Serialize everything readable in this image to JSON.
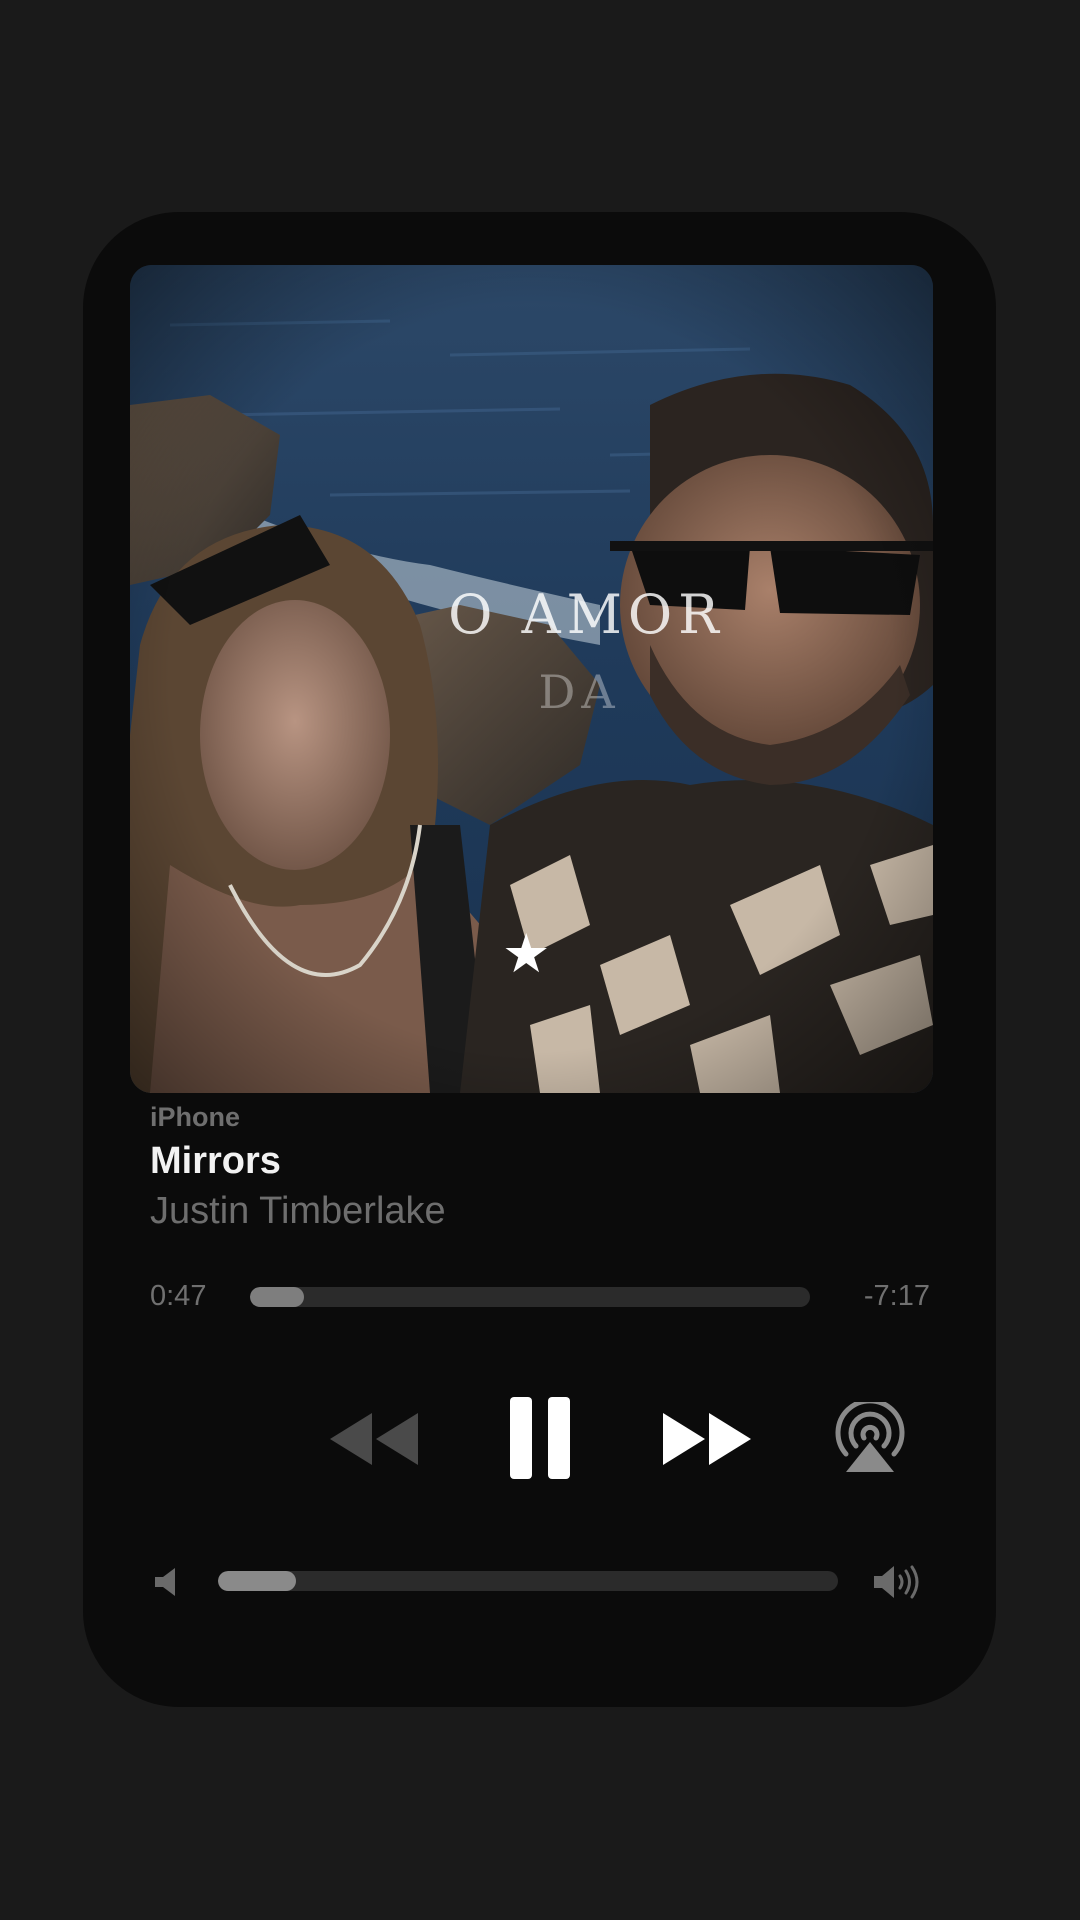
{
  "player": {
    "source": "iPhone",
    "song_title": "Mirrors",
    "artist": "Justin Timberlake",
    "elapsed": "0:47",
    "remaining": "-7:17",
    "progress_fraction": 0.097,
    "volume_fraction": 0.125
  },
  "artwork": {
    "caption_line1": "O AMOR",
    "caption_line2": "DA"
  },
  "controls": {
    "rewind_icon": "rewind-icon",
    "pause_icon": "pause-icon",
    "forward_icon": "fast-forward-icon",
    "airplay_icon": "airplay-icon",
    "volume_min_icon": "speaker-min-icon",
    "volume_max_icon": "speaker-max-icon"
  },
  "colors": {
    "background": "#1a1a1a",
    "card": "#0b0b0b",
    "title": "#f2f2f2",
    "secondary_text": "#6e6e6e",
    "track": "#2b2b2b",
    "fill": "#7e7e7e",
    "rewind_disabled": "#4a4a4a",
    "active_icon": "#ffffff"
  }
}
